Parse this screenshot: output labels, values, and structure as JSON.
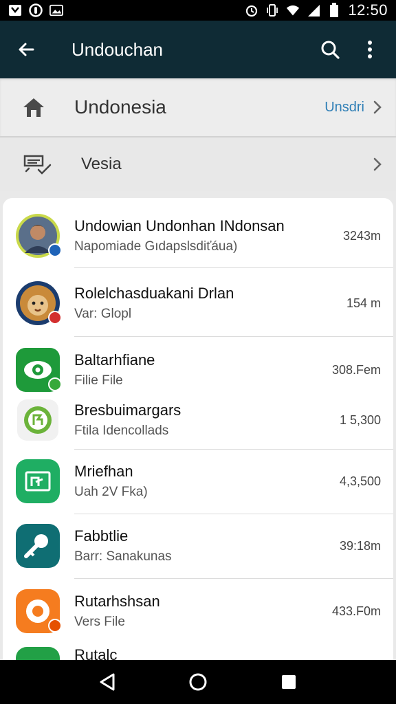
{
  "status_bar": {
    "time": "12:50",
    "left_icons": [
      "notification-icon",
      "whatsapp-icon",
      "image-icon"
    ],
    "right_icons": [
      "alarm-icon",
      "vibrate-icon",
      "wifi-icon",
      "signal-icon",
      "battery-icon"
    ]
  },
  "app_bar": {
    "title": "Undouchan"
  },
  "home_row": {
    "label": "Undonesia",
    "value": "Unsdri"
  },
  "vesia_row": {
    "label": "Vesia"
  },
  "items": [
    {
      "title": "Undowian Undonhan INdonsan",
      "subtitle": "Napomiade Gıdapslsdiťáua)",
      "size": "3243m",
      "badge_color": "#1e63b8"
    },
    {
      "title": "Rolelchasduakani Drlan",
      "subtitle": "Var: Glopl",
      "size": "154 m",
      "badge_color": "#d32f2f"
    },
    {
      "title": "Baltarhfiane",
      "subtitle": "Filie File",
      "size": "308.Fem",
      "badge_color": "#37a93a"
    },
    {
      "title": "Bresbuimargars",
      "subtitle": "Ftila Idencollads",
      "size": "1 5,300",
      "badge_color": ""
    },
    {
      "title": "Mriefhan",
      "subtitle": "Uah 2V Fka)",
      "size": "4,3,500",
      "badge_color": ""
    },
    {
      "title": "Fabbtlie",
      "subtitle": "Barr: Sanakunas",
      "size": "39:18m",
      "badge_color": ""
    },
    {
      "title": "Rutarhshsan",
      "subtitle": "Vers File",
      "size": "433.F0m",
      "badge_color": "#e65100"
    },
    {
      "title": "Rutalc",
      "subtitle": "",
      "size": "",
      "badge_color": ""
    }
  ],
  "colors": {
    "app_bar": "#0f2b35",
    "accent_link": "#2f7fb6"
  }
}
